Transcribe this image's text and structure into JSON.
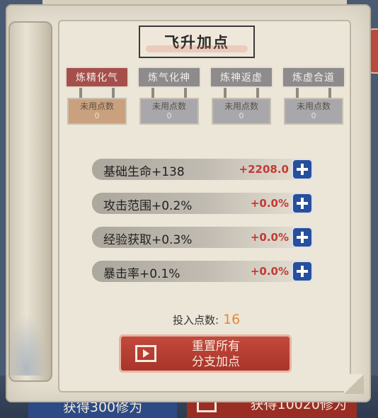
{
  "title": "飞升加点",
  "branches": [
    {
      "name": "炼精化气",
      "points_label": "未用点数",
      "points": "0",
      "active": true
    },
    {
      "name": "炼气化神",
      "points_label": "未用点数",
      "points": "0",
      "active": false
    },
    {
      "name": "炼神返虚",
      "points_label": "未用点数",
      "points": "0",
      "active": false
    },
    {
      "name": "炼虚合道",
      "points_label": "未用点数",
      "points": "0",
      "active": false
    }
  ],
  "stats": [
    {
      "label": "基础生命+138",
      "value": "+2208.0"
    },
    {
      "label": "攻击范围+0.2%",
      "value": "+0.0%"
    },
    {
      "label": "经验获取+0.3%",
      "value": "+0.0%"
    },
    {
      "label": "暴击率+0.1%",
      "value": "+0.0%"
    }
  ],
  "invested": {
    "label": "投入点数:",
    "value": "16"
  },
  "reset_button": {
    "line1": "重置所有",
    "line2": "分支加点"
  },
  "background": {
    "bottom_left": "获得300修为",
    "bottom_right": "获得10020修为"
  },
  "colors": {
    "active_tab": "#a54f4c",
    "inactive_tab": "#8d8b8c",
    "plus_button": "#274f9c",
    "stat_value": "#c43a35",
    "reset_button": "#b43c30",
    "invested_number": "#e08a3b"
  }
}
